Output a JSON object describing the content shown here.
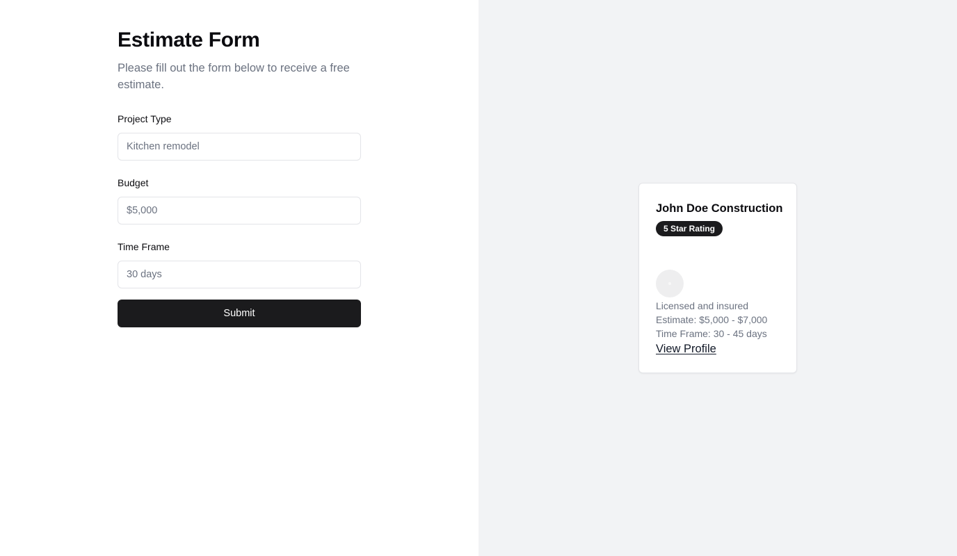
{
  "form": {
    "title": "Estimate Form",
    "subtitle": "Please fill out the form below to receive a free estimate.",
    "fields": [
      {
        "label": "Project Type",
        "placeholder": "Kitchen remodel",
        "value": ""
      },
      {
        "label": "Budget",
        "placeholder": "$5,000",
        "value": ""
      },
      {
        "label": "Time Frame",
        "placeholder": "30 days",
        "value": ""
      }
    ],
    "submit_label": "Submit"
  },
  "contractor_card": {
    "name": "John Doe Construction",
    "badge": "5 Star Rating",
    "avatar_icon": "avatar-placeholder-icon",
    "details": [
      "Licensed and insured",
      "Estimate: $5,000 - $7,000",
      "Time Frame: 30 - 45 days"
    ],
    "link_label": "View Profile"
  },
  "colors": {
    "primary_button": "#1b1b1d",
    "muted_text": "#6b7280",
    "right_panel_bg": "#f2f3f5",
    "border": "#e3e4e8"
  }
}
